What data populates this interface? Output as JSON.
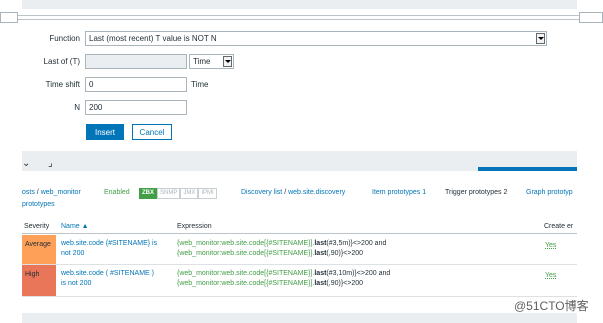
{
  "form": {
    "function_label": "Function",
    "function_value": "Last (most recent) T value is NOT N",
    "last_of_label": "Last of (T)",
    "last_of_value": "",
    "last_of_unit": "Time",
    "time_shift_label": "Time shift",
    "time_shift_value": "0",
    "time_shift_unit": "Time",
    "n_label": "N",
    "n_value": "200",
    "insert_label": "Insert",
    "cancel_label": "Cancel"
  },
  "nav": {
    "hosts": "osts",
    "sep1": "/",
    "host": "web_monitor",
    "enabled": "Enabled",
    "zbx": "ZBX",
    "snmp": "SNMP",
    "jmx": "JMX",
    "ipmi": "IPMI",
    "discovery_list": "Discovery list",
    "sep2": "/",
    "discovery": "web.site.discovery",
    "item_prototypes": "Item prototypes 1",
    "trigger_prototypes": "Trigger prototypes 2",
    "graph_prototypes": "Graph prototyp",
    "host_prototypes": "prototypes"
  },
  "table": {
    "headers": {
      "severity": "Severity",
      "name": "Name ▲",
      "expression": "Expression",
      "create": "Create er"
    },
    "rows": [
      {
        "severity": "Average",
        "name_line1": "web.site.code {#SITENAME} is",
        "name_line2": "not 200",
        "expr1_a": "{web_monitor:web.site.code[{#SITENAME}].",
        "expr1_fn": "last",
        "expr1_b": "(#3,5m)}<>200 and",
        "expr2_a": "{web_monitor:web.site.code[{#SITENAME}].",
        "expr2_fn": "last",
        "expr2_b": "(,90)}<>200",
        "create": "Yes",
        "color": "#ffa059"
      },
      {
        "severity": "High",
        "name_line1": "web.site.code ( #SITENAME )",
        "name_line2": "is not 200",
        "expr1_a": "{web_monitor:web.site.code[{#SITENAME}].",
        "expr1_fn": "last",
        "expr1_b": "(#3,10m)}<>200 and",
        "expr2_a": "{web_monitor:web.site.code[{#SITENAME}].",
        "expr2_fn": "last",
        "expr2_b": "(,90)}<>200",
        "create": "Yes",
        "color": "#e97659"
      }
    ]
  },
  "watermark": "@51CTO博客",
  "colors": {
    "accent": "#0275b8",
    "green": "#429e47",
    "band": "#ebeef0"
  }
}
